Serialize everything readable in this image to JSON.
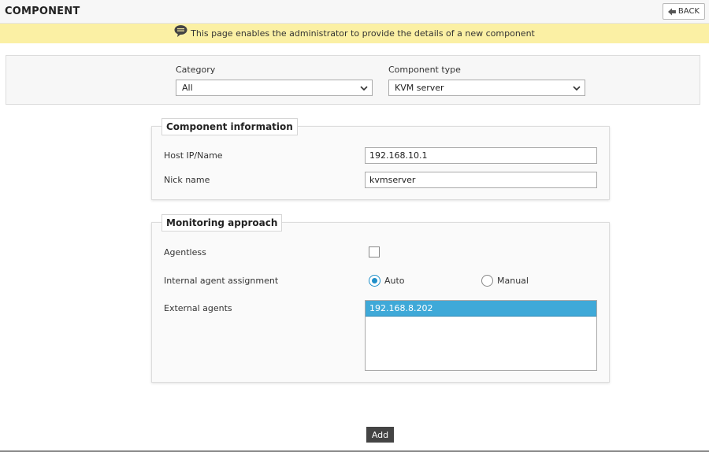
{
  "header": {
    "title": "COMPONENT",
    "back_label": "BACK"
  },
  "info_bar": {
    "message": "This page enables the administrator to provide the details of a new component",
    "icon": "speech-bubble-icon"
  },
  "filters": {
    "category_label": "Category",
    "category_value": "All",
    "component_type_label": "Component type",
    "component_type_value": "KVM server"
  },
  "component_information": {
    "legend": "Component information",
    "host_label": "Host IP/Name",
    "host_value": "192.168.10.1",
    "nick_label": "Nick name",
    "nick_value": "kvmserver"
  },
  "monitoring_approach": {
    "legend": "Monitoring approach",
    "agentless_label": "Agentless",
    "agentless_checked": false,
    "internal_agent_label": "Internal agent assignment",
    "radio_auto_label": "Auto",
    "radio_manual_label": "Manual",
    "selected_assignment": "Auto",
    "external_agents_label": "External agents",
    "external_agents": [
      "192.168.8.202"
    ]
  },
  "actions": {
    "add_label": "Add"
  },
  "colors": {
    "info_bar": "#fbf0a4",
    "selected_item": "#3fa9d8",
    "add_button": "#444444"
  }
}
